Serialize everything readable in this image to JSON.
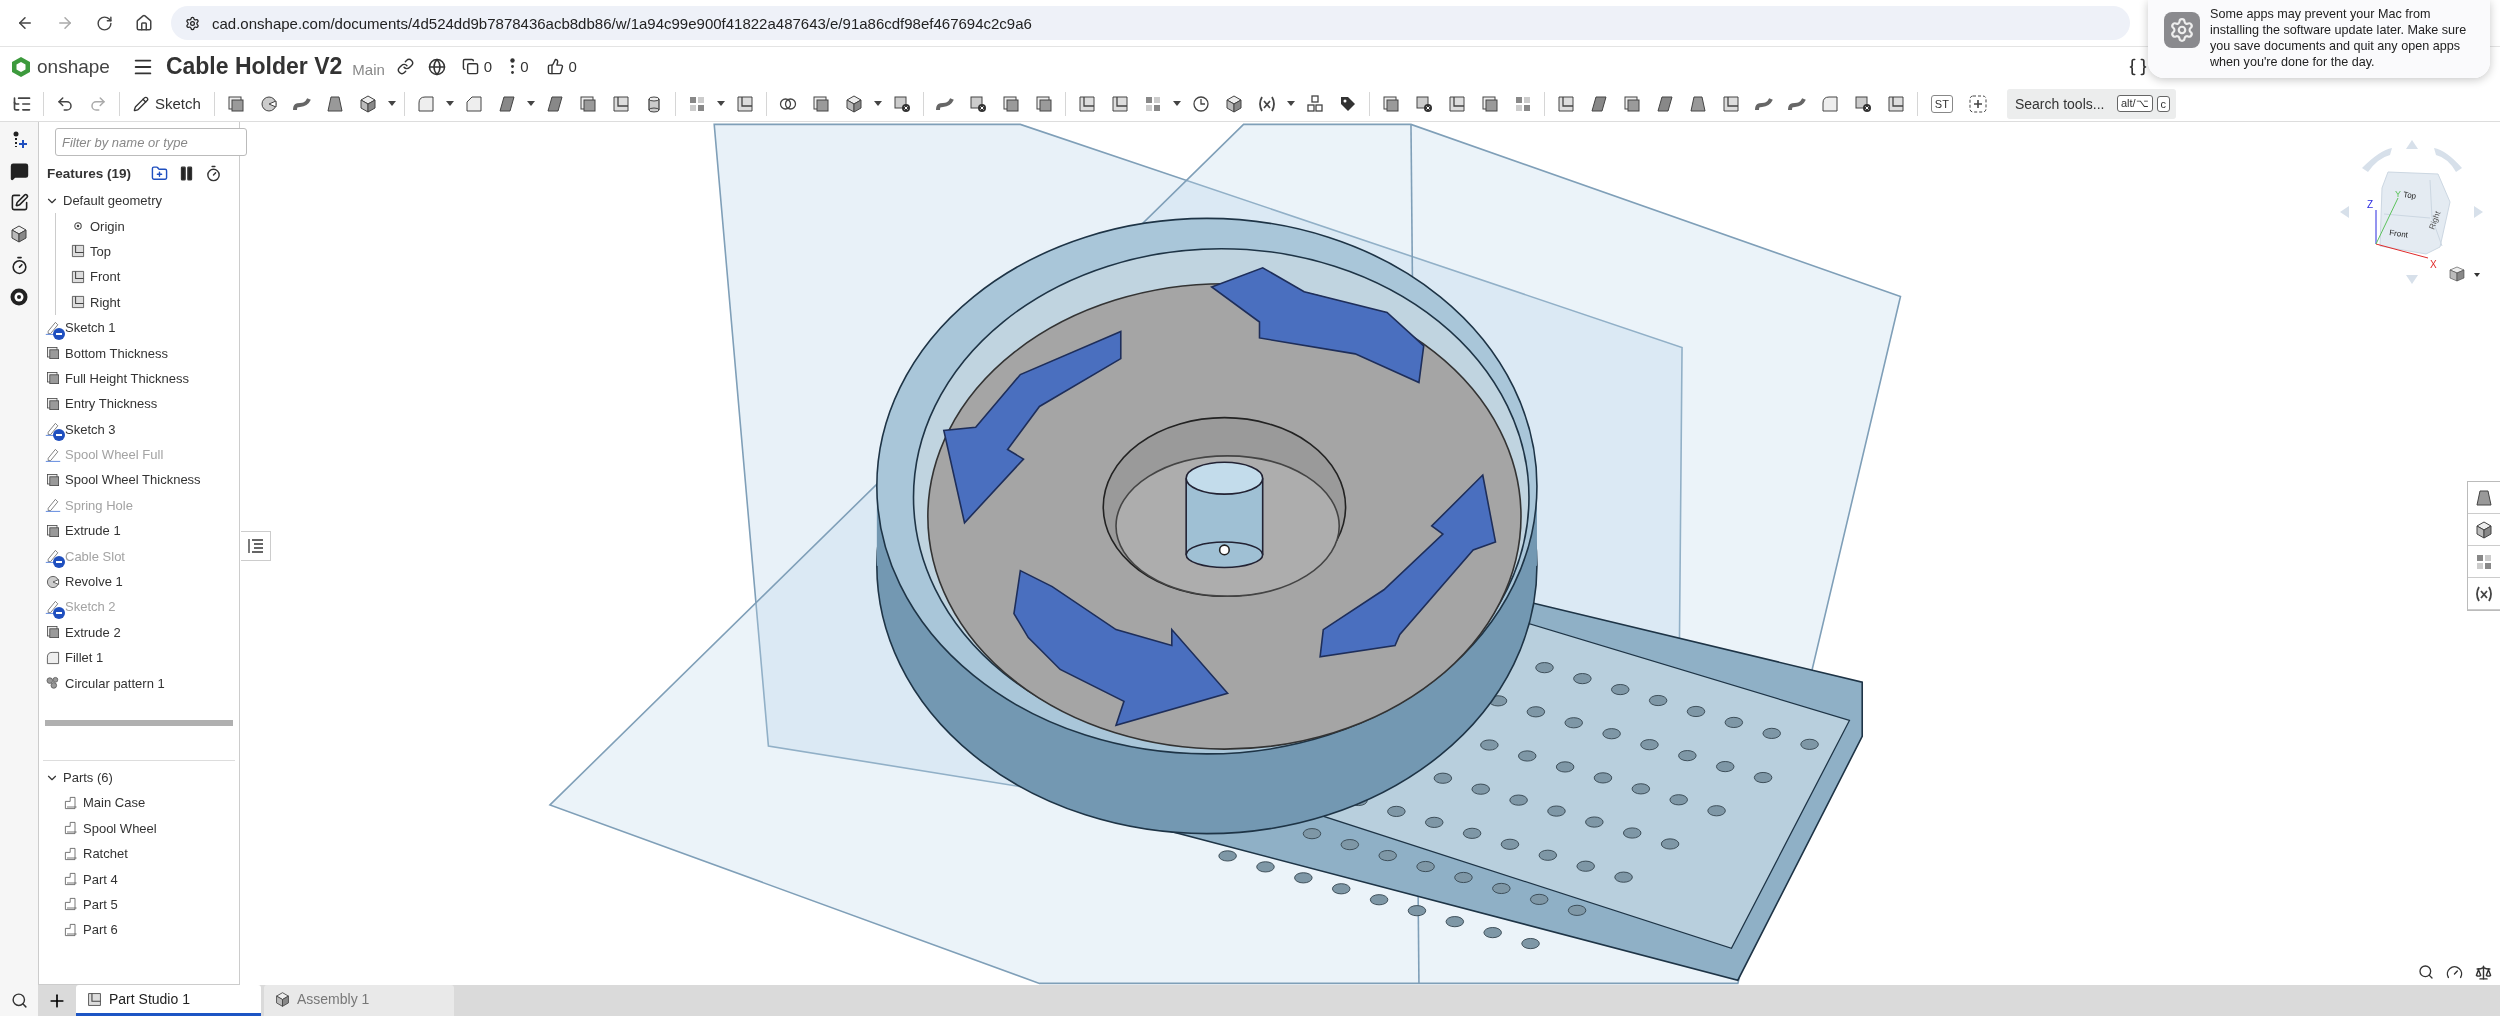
{
  "browser": {
    "url": "cad.onshape.com/documents/4d524dd9b7878436acb8db86/w/1a94c99e900f41822a487643/e/91a86cdf98ef467694c2c9a6"
  },
  "app_header": {
    "logo": "onshape",
    "title": "Cable Holder V2",
    "branch": "Main",
    "counters": [
      "0",
      "0",
      "0"
    ]
  },
  "toolbar": {
    "sketch_button": "Sketch",
    "st_label": "ST",
    "search": {
      "placeholder": "Search tools...",
      "shortcut_keys": [
        "alt/⌥",
        "c"
      ]
    }
  },
  "notification": {
    "message": "Some apps may prevent your Mac from installing the software update later. Make sure you save documents and quit any open apps when you're done for the day."
  },
  "feature_panel": {
    "filter_placeholder": "Filter by name or type",
    "features_heading": "Features (19)",
    "features": [
      {
        "label": "Default geometry",
        "kind": "folder",
        "expanded": true,
        "dimmed": false,
        "children": [
          {
            "label": "Origin",
            "kind": "origin"
          },
          {
            "label": "Top",
            "kind": "plane"
          },
          {
            "label": "Front",
            "kind": "plane"
          },
          {
            "label": "Right",
            "kind": "plane"
          }
        ]
      },
      {
        "label": "Sketch 1",
        "kind": "sketch",
        "dimmed": false,
        "hidden": true
      },
      {
        "label": "Bottom Thickness",
        "kind": "extrude",
        "dimmed": false,
        "hidden": false
      },
      {
        "label": "Full Height Thickness",
        "kind": "extrude",
        "dimmed": false,
        "hidden": false
      },
      {
        "label": "Entry Thickness",
        "kind": "extrude",
        "dimmed": false,
        "hidden": false
      },
      {
        "label": "Sketch 3",
        "kind": "sketch",
        "dimmed": false,
        "hidden": true
      },
      {
        "label": "Spool Wheel Full",
        "kind": "sketch",
        "dimmed": true,
        "hidden": false
      },
      {
        "label": "Spool Wheel Thickness",
        "kind": "extrude",
        "dimmed": false,
        "hidden": false
      },
      {
        "label": "Spring Hole",
        "kind": "sketch",
        "dimmed": true,
        "hidden": false
      },
      {
        "label": "Extrude 1",
        "kind": "extrude",
        "dimmed": false,
        "hidden": false
      },
      {
        "label": "Cable Slot",
        "kind": "sketch",
        "dimmed": true,
        "hidden": true
      },
      {
        "label": "Revolve 1",
        "kind": "revolve",
        "dimmed": false,
        "hidden": false
      },
      {
        "label": "Sketch 2",
        "kind": "sketch",
        "dimmed": true,
        "hidden": true
      },
      {
        "label": "Extrude 2",
        "kind": "extrude",
        "dimmed": false,
        "hidden": false
      },
      {
        "label": "Fillet 1",
        "kind": "fillet",
        "dimmed": false,
        "hidden": false
      },
      {
        "label": "Circular pattern 1",
        "kind": "pattern",
        "dimmed": false,
        "hidden": false
      }
    ],
    "parts": {
      "label": "Parts (6)",
      "expanded": true,
      "children": [
        {
          "label": "Main Case"
        },
        {
          "label": "Spool Wheel"
        },
        {
          "label": "Ratchet"
        },
        {
          "label": "Part 4"
        },
        {
          "label": "Part 5"
        },
        {
          "label": "Part 6"
        }
      ]
    }
  },
  "view_cube": {
    "faces": [
      "Top",
      "Front",
      "Right"
    ],
    "axes": [
      "X",
      "Y",
      "Z"
    ]
  },
  "document_tabs": [
    {
      "label": "Part Studio 1",
      "kind": "part_studio",
      "selected": true
    },
    {
      "label": "Assembly 1",
      "kind": "assembly",
      "selected": false
    }
  ]
}
